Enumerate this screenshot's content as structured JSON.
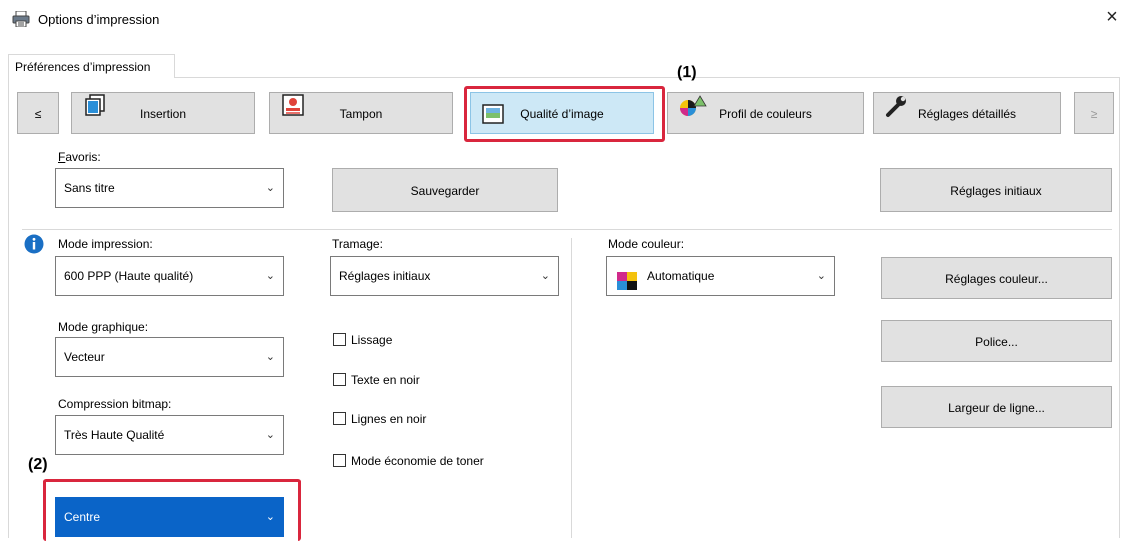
{
  "window": {
    "title": "Options d’impression",
    "close": "×"
  },
  "tab": {
    "label": "Préférences d’impression"
  },
  "nav": {
    "prev": "≤",
    "next": "≥",
    "buttons": [
      {
        "label": "Insertion",
        "icon": "documents-stack-icon"
      },
      {
        "label": "Tampon",
        "icon": "stamp-icon"
      },
      {
        "label": "Qualité d’image",
        "icon": "image-quality-icon",
        "selected": true
      },
      {
        "label": "Profil de couleurs",
        "icon": "color-profile-icon"
      },
      {
        "label": "Réglages détaillés",
        "icon": "wrench-icon"
      }
    ]
  },
  "favoris": {
    "label": "Favoris:",
    "value": "Sans titre",
    "save_label": "Sauvegarder",
    "initial_label": "Réglages initiaux"
  },
  "mode_impression": {
    "label": "Mode impression:",
    "value": "600 PPP (Haute qualité)"
  },
  "tramage": {
    "label": "Tramage:",
    "value": "Réglages initiaux"
  },
  "mode_couleur": {
    "label": "Mode couleur:",
    "value": "Automatique"
  },
  "mode_graphique": {
    "label": "Mode graphique:",
    "value": "Vecteur"
  },
  "compression": {
    "label": "Compression bitmap:",
    "value": "Très Haute Qualité"
  },
  "trame": {
    "value": "Centre"
  },
  "checkboxes": [
    {
      "label": "Lissage",
      "checked": false
    },
    {
      "label": "Texte en noir",
      "checked": false
    },
    {
      "label": "Lignes en noir",
      "checked": false
    },
    {
      "label": "Mode économie de toner",
      "checked": false
    }
  ],
  "right_buttons": {
    "color_settings": "Réglages couleur...",
    "font": "Police...",
    "line_width": "Largeur de ligne..."
  },
  "annotations": {
    "one": "(1)",
    "two": "(2)"
  },
  "colors": {
    "highlight": "#d9263d",
    "selected_tab": "#cde8f6",
    "selected_combo": "#0a64c8",
    "info": "#1a6fc4"
  }
}
